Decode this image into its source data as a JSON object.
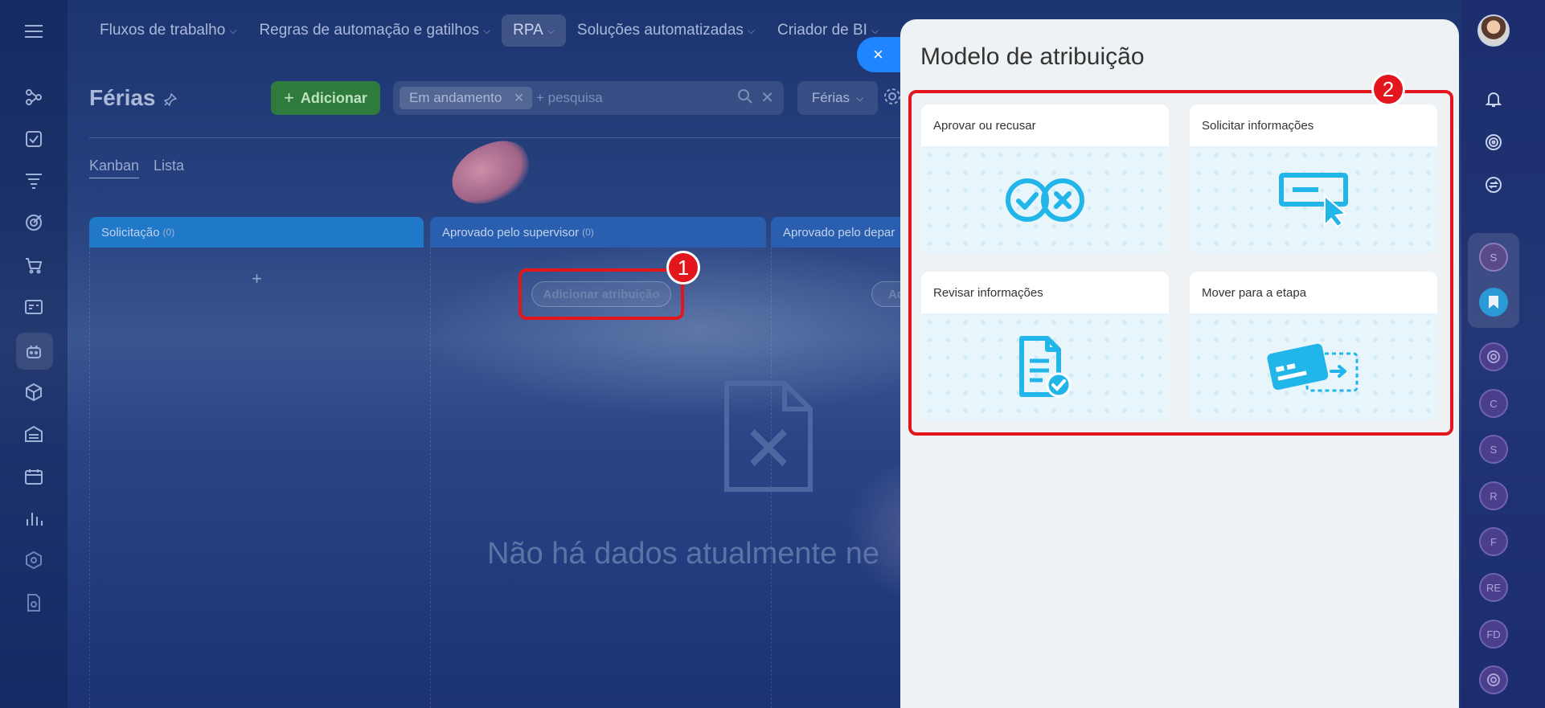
{
  "topnav": {
    "items": [
      {
        "label": "Fluxos de trabalho",
        "chevron": "⌵"
      },
      {
        "label": "Regras de automação e gatilhos",
        "chevron": "⌵"
      },
      {
        "label": "RPA",
        "chevron": "⌵"
      },
      {
        "label": "Soluções automatizadas",
        "chevron": "⌵"
      },
      {
        "label": "Criador de BI",
        "chevron": "⌵"
      }
    ]
  },
  "header": {
    "title": "Férias",
    "add_label": "Adicionar",
    "add_plus": "+",
    "filter_chip": "Em andamento",
    "search_placeholder": "+ pesquisa",
    "view_select": "Férias"
  },
  "views": {
    "kanban": "Kanban",
    "lista": "Lista"
  },
  "kanban": {
    "columns": [
      {
        "title": "Solicitação",
        "count": "(0)"
      },
      {
        "title": "Aprovado pelo supervisor",
        "count": "(0)"
      },
      {
        "title": "Aprovado pelo depar",
        "count": ""
      }
    ],
    "add_symbol": "+",
    "assign_label": "Adicionar atribuição",
    "assign_label_partial": "Ad",
    "empty_text": "Não há dados atualmente ne"
  },
  "annotations": {
    "badge1": "1",
    "badge2": "2"
  },
  "panel": {
    "close": "×",
    "title": "Modelo de atribuição",
    "cards": [
      {
        "title": "Aprovar ou recusar",
        "icon": "approve-reject-icon"
      },
      {
        "title": "Solicitar informações",
        "icon": "request-info-icon"
      },
      {
        "title": "Revisar informações",
        "icon": "review-doc-icon"
      },
      {
        "title": "Mover para a etapa",
        "icon": "move-stage-icon"
      }
    ]
  },
  "right_sidebar": {
    "avatars": [
      "S",
      "C",
      "S",
      "R",
      "F",
      "RE",
      "FD"
    ]
  },
  "colors": {
    "accent": "#1f86ff",
    "annotation": "#e3161e",
    "icon_blue": "#22b5ea",
    "add_green": "#2f7a3d"
  }
}
